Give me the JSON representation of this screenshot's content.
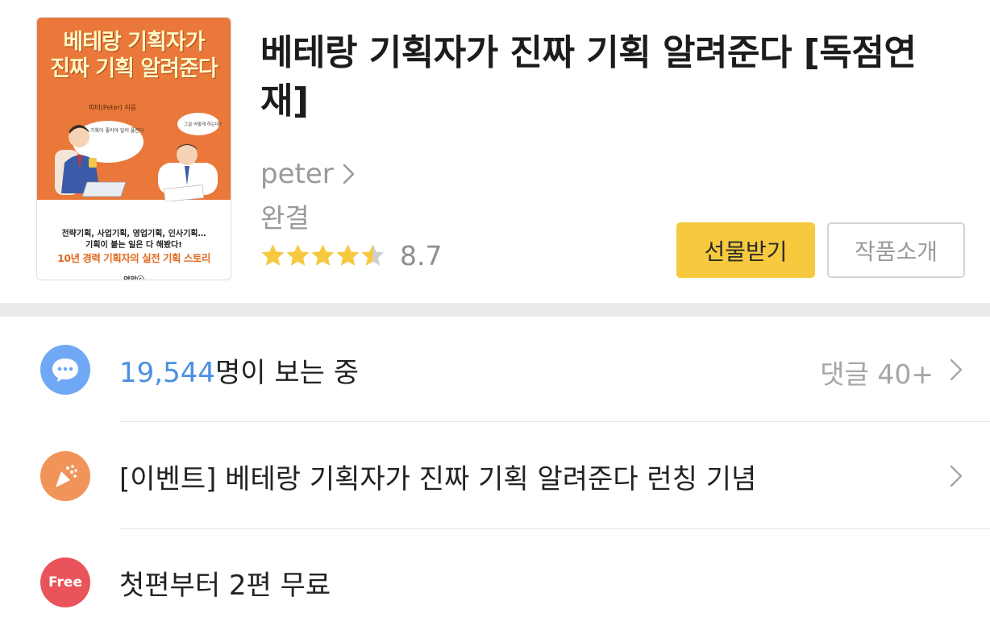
{
  "book": {
    "cover_title_line1": "베테랑 기획자가",
    "cover_title_line2": "진짜 기획 알려준다",
    "cover_author": "피터(Peter) 지음",
    "cover_bubble_left": "기획이 좋아야 일이 풀린다",
    "cover_bubble_right": "그걸 어떻게 하는데?",
    "cover_blurb_line1": "전략기획, 사업기획, 영업기획, 인사기획…",
    "cover_blurb_line2": "기획이 붙는 일은 다 해봤다!",
    "cover_tagline": "10년 경력 기획자의 실전 기획 스토리",
    "cover_publisher": "연암ⓒ",
    "title": "베테랑 기획자가 진짜 기획 알려준다 [독점연재]",
    "author": "peter",
    "status": "완결",
    "rating": "8.7",
    "rating_stars": 4.5
  },
  "buttons": {
    "gift": "선물받기",
    "intro": "작품소개"
  },
  "rows": {
    "viewers": {
      "count": "19,544",
      "suffix": "명이 보는 중",
      "comments": "댓글 40+"
    },
    "event": {
      "label": "[이벤트] 베테랑 기획자가 진짜 기획 알려준다 런칭 기념"
    },
    "free": {
      "badge": "Free",
      "label": "첫편부터 2편 무료"
    }
  },
  "colors": {
    "accent_yellow": "#f6c93e",
    "viewer_blue": "#4a90e2",
    "chat_icon_bg": "#6fa8f5",
    "event_icon_bg": "#f0945a",
    "free_icon_bg": "#e8545a",
    "star": "#f6c93e"
  },
  "icons": {
    "chat": "chat-bubble-icon",
    "event": "party-popper-icon",
    "free": "free-badge-icon",
    "chevron": "chevron-right-icon",
    "star": "star-icon"
  }
}
